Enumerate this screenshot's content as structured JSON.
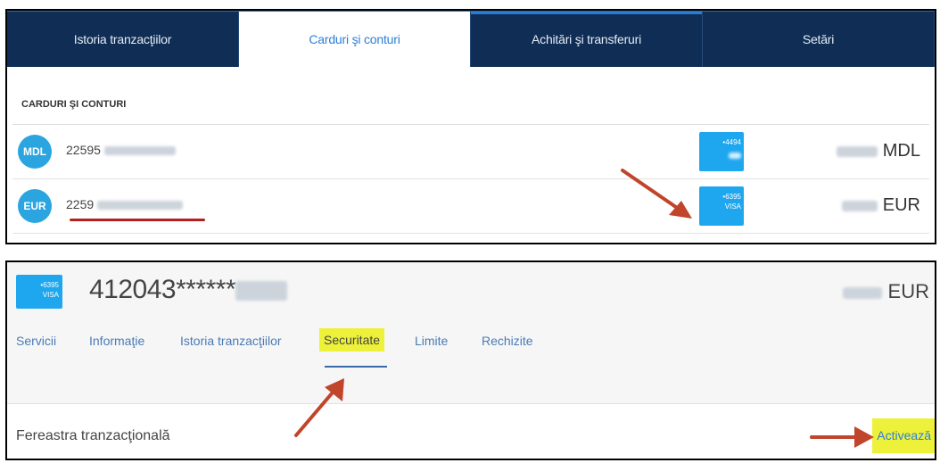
{
  "tabs": [
    {
      "label": "Istoria tranzacţiilor",
      "active": false
    },
    {
      "label": "Carduri şi conturi",
      "active": true
    },
    {
      "label": "Achitări şi transferuri",
      "active": false
    },
    {
      "label": "Setări",
      "active": false
    }
  ],
  "section_title": "CARDURI ŞI CONTURI",
  "accounts": [
    {
      "currency_badge": "MDL",
      "account_prefix": "22595",
      "card_suffix": "•4494",
      "card_brand": "",
      "balance_currency": "MDL"
    },
    {
      "currency_badge": "EUR",
      "account_prefix": "2259",
      "card_suffix": "•6395",
      "card_brand": "VISA",
      "balance_currency": "EUR"
    }
  ],
  "card_detail": {
    "card_suffix": "•6395",
    "card_brand": "VISA",
    "card_number": "412043******",
    "balance_currency": "EUR"
  },
  "subtabs": [
    "Servicii",
    "Informaţie",
    "Istoria tranzacţiilor",
    "Securitate",
    "Limite",
    "Rechizite"
  ],
  "security": {
    "label": "Fereastra tranzacţională",
    "action": "Activează"
  },
  "colors": {
    "nav_bg": "#0f2d55",
    "accent_blue": "#2c7fd6",
    "card_blue": "#1ea7ef",
    "currency_badge": "#2aa5e0",
    "highlight": "#eef13a",
    "arrow": "#c0452a"
  }
}
